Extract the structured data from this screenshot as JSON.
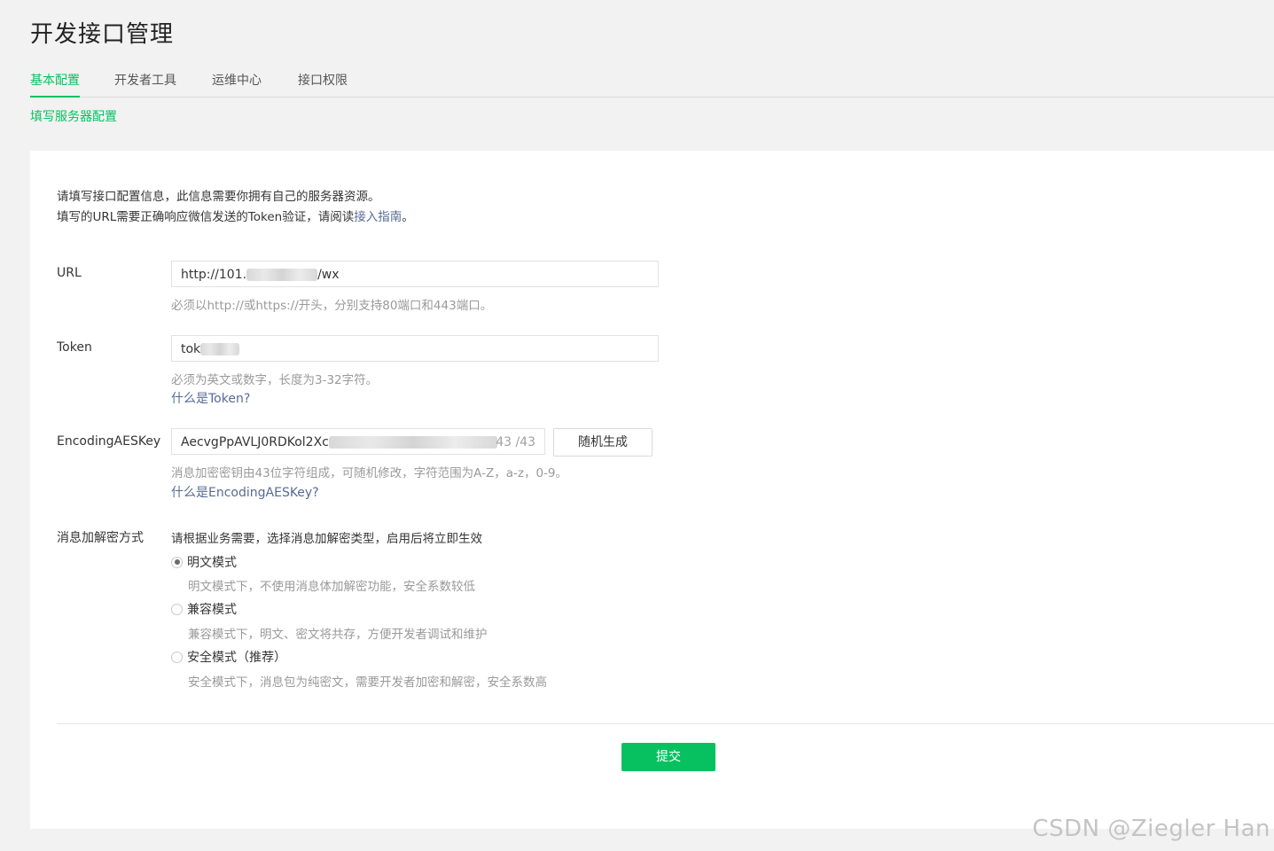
{
  "page": {
    "title": "开发接口管理"
  },
  "tabs": [
    {
      "label": "基本配置",
      "active": true
    },
    {
      "label": "开发者工具",
      "active": false
    },
    {
      "label": "运维中心",
      "active": false
    },
    {
      "label": "接口权限",
      "active": false
    }
  ],
  "subnav": {
    "label": "填写服务器配置"
  },
  "intro": {
    "line1": "请填写接口配置信息，此信息需要你拥有自己的服务器资源。",
    "line2_prefix": "填写的URL需要正确响应微信发送的Token验证，请阅读",
    "line2_link": "接入指南",
    "line2_suffix": "。"
  },
  "form": {
    "url": {
      "label": "URL",
      "value_prefix": "http://101.",
      "value_suffix": "/wx",
      "hint": "必须以http://或https://开头，分别支持80端口和443端口。"
    },
    "token": {
      "label": "Token",
      "value_prefix": "tok",
      "hint": "必须为英文或数字，长度为3-32字符。",
      "help_link": "什么是Token?"
    },
    "aeskey": {
      "label": "EncodingAESKey",
      "value_prefix": "AecvgPpAVLJ0RDKol2Xc",
      "counter": "43 /43",
      "random_button": "随机生成",
      "hint": "消息加密密钥由43位字符组成，可随机修改，字符范围为A-Z，a-z，0-9。",
      "help_link": "什么是EncodingAESKey?"
    },
    "encryption": {
      "label": "消息加解密方式",
      "description": "请根据业务需要，选择消息加解密类型，启用后将立即生效",
      "options": [
        {
          "label": "明文模式",
          "desc": "明文模式下，不使用消息体加解密功能，安全系数较低",
          "checked": true
        },
        {
          "label": "兼容模式",
          "desc": "兼容模式下，明文、密文将共存，方便开发者调试和维护",
          "checked": false
        },
        {
          "label": "安全模式（推荐）",
          "desc": "安全模式下，消息包为纯密文，需要开发者加密和解密，安全系数高",
          "checked": false
        }
      ]
    },
    "submit_label": "提交"
  },
  "watermark": "CSDN @Ziegler Han",
  "colors": {
    "accent": "#07c160",
    "link": "#576b95"
  }
}
